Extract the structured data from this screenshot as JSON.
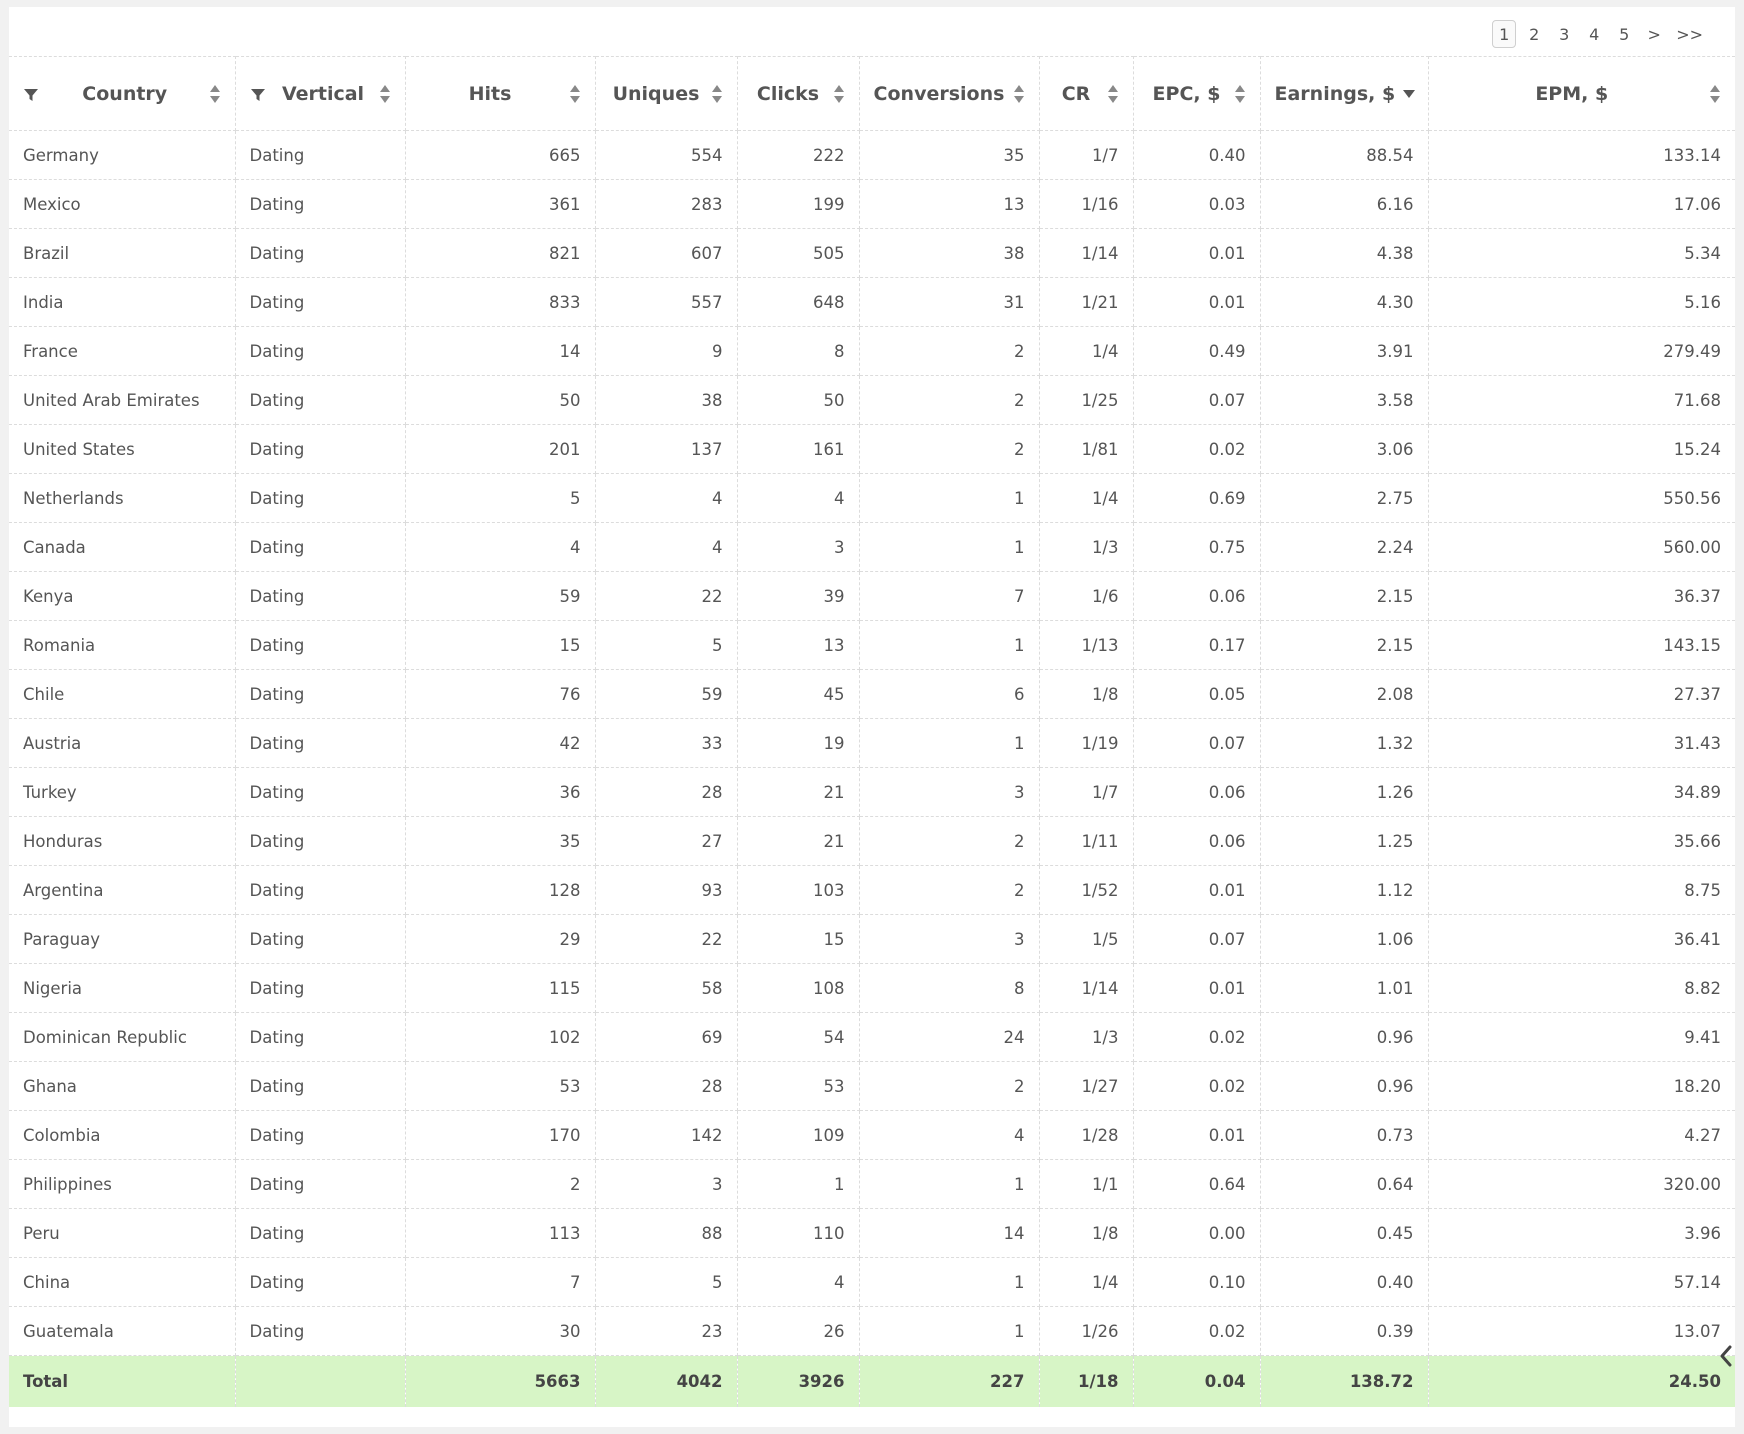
{
  "pagination": {
    "pages": [
      "1",
      "2",
      "3",
      "4",
      "5",
      ">",
      ">>"
    ],
    "active": "1"
  },
  "columns": [
    {
      "key": "country",
      "label": "Country",
      "filter": true,
      "sort": "both"
    },
    {
      "key": "vertical",
      "label": "Vertical",
      "filter": true,
      "sort": "both"
    },
    {
      "key": "hits",
      "label": "Hits",
      "filter": false,
      "sort": "both"
    },
    {
      "key": "uniques",
      "label": "Uniques",
      "filter": false,
      "sort": "both"
    },
    {
      "key": "clicks",
      "label": "Clicks",
      "filter": false,
      "sort": "both"
    },
    {
      "key": "conversions",
      "label": "Conversions",
      "filter": false,
      "sort": "both"
    },
    {
      "key": "cr",
      "label": "CR",
      "filter": false,
      "sort": "both"
    },
    {
      "key": "epc",
      "label": "EPC, $",
      "filter": false,
      "sort": "both"
    },
    {
      "key": "earnings",
      "label": "Earnings, $",
      "filter": false,
      "sort": "desc"
    },
    {
      "key": "epm",
      "label": "EPM, $",
      "filter": false,
      "sort": "both"
    }
  ],
  "rows": [
    [
      "Germany",
      "Dating",
      "665",
      "554",
      "222",
      "35",
      "1/7",
      "0.40",
      "88.54",
      "133.14"
    ],
    [
      "Mexico",
      "Dating",
      "361",
      "283",
      "199",
      "13",
      "1/16",
      "0.03",
      "6.16",
      "17.06"
    ],
    [
      "Brazil",
      "Dating",
      "821",
      "607",
      "505",
      "38",
      "1/14",
      "0.01",
      "4.38",
      "5.34"
    ],
    [
      "India",
      "Dating",
      "833",
      "557",
      "648",
      "31",
      "1/21",
      "0.01",
      "4.30",
      "5.16"
    ],
    [
      "France",
      "Dating",
      "14",
      "9",
      "8",
      "2",
      "1/4",
      "0.49",
      "3.91",
      "279.49"
    ],
    [
      "United Arab Emirates",
      "Dating",
      "50",
      "38",
      "50",
      "2",
      "1/25",
      "0.07",
      "3.58",
      "71.68"
    ],
    [
      "United States",
      "Dating",
      "201",
      "137",
      "161",
      "2",
      "1/81",
      "0.02",
      "3.06",
      "15.24"
    ],
    [
      "Netherlands",
      "Dating",
      "5",
      "4",
      "4",
      "1",
      "1/4",
      "0.69",
      "2.75",
      "550.56"
    ],
    [
      "Canada",
      "Dating",
      "4",
      "4",
      "3",
      "1",
      "1/3",
      "0.75",
      "2.24",
      "560.00"
    ],
    [
      "Kenya",
      "Dating",
      "59",
      "22",
      "39",
      "7",
      "1/6",
      "0.06",
      "2.15",
      "36.37"
    ],
    [
      "Romania",
      "Dating",
      "15",
      "5",
      "13",
      "1",
      "1/13",
      "0.17",
      "2.15",
      "143.15"
    ],
    [
      "Chile",
      "Dating",
      "76",
      "59",
      "45",
      "6",
      "1/8",
      "0.05",
      "2.08",
      "27.37"
    ],
    [
      "Austria",
      "Dating",
      "42",
      "33",
      "19",
      "1",
      "1/19",
      "0.07",
      "1.32",
      "31.43"
    ],
    [
      "Turkey",
      "Dating",
      "36",
      "28",
      "21",
      "3",
      "1/7",
      "0.06",
      "1.26",
      "34.89"
    ],
    [
      "Honduras",
      "Dating",
      "35",
      "27",
      "21",
      "2",
      "1/11",
      "0.06",
      "1.25",
      "35.66"
    ],
    [
      "Argentina",
      "Dating",
      "128",
      "93",
      "103",
      "2",
      "1/52",
      "0.01",
      "1.12",
      "8.75"
    ],
    [
      "Paraguay",
      "Dating",
      "29",
      "22",
      "15",
      "3",
      "1/5",
      "0.07",
      "1.06",
      "36.41"
    ],
    [
      "Nigeria",
      "Dating",
      "115",
      "58",
      "108",
      "8",
      "1/14",
      "0.01",
      "1.01",
      "8.82"
    ],
    [
      "Dominican Republic",
      "Dating",
      "102",
      "69",
      "54",
      "24",
      "1/3",
      "0.02",
      "0.96",
      "9.41"
    ],
    [
      "Ghana",
      "Dating",
      "53",
      "28",
      "53",
      "2",
      "1/27",
      "0.02",
      "0.96",
      "18.20"
    ],
    [
      "Colombia",
      "Dating",
      "170",
      "142",
      "109",
      "4",
      "1/28",
      "0.01",
      "0.73",
      "4.27"
    ],
    [
      "Philippines",
      "Dating",
      "2",
      "3",
      "1",
      "1",
      "1/1",
      "0.64",
      "0.64",
      "320.00"
    ],
    [
      "Peru",
      "Dating",
      "113",
      "88",
      "110",
      "14",
      "1/8",
      "0.00",
      "0.45",
      "3.96"
    ],
    [
      "China",
      "Dating",
      "7",
      "5",
      "4",
      "1",
      "1/4",
      "0.10",
      "0.40",
      "57.14"
    ],
    [
      "Guatemala",
      "Dating",
      "30",
      "23",
      "26",
      "1",
      "1/26",
      "0.02",
      "0.39",
      "13.07"
    ]
  ],
  "total": [
    "Total",
    "",
    "5663",
    "4042",
    "3926",
    "227",
    "1/18",
    "0.04",
    "138.72",
    "24.50"
  ],
  "icons": {
    "filter": "filter-icon",
    "sort": "sort-icon",
    "sort_desc": "sort-desc-icon",
    "collapse": "chevron-left-icon"
  },
  "colors": {
    "total_row_bg": "#d7f5c6",
    "border": "#dcdcdc",
    "text": "#555555"
  }
}
